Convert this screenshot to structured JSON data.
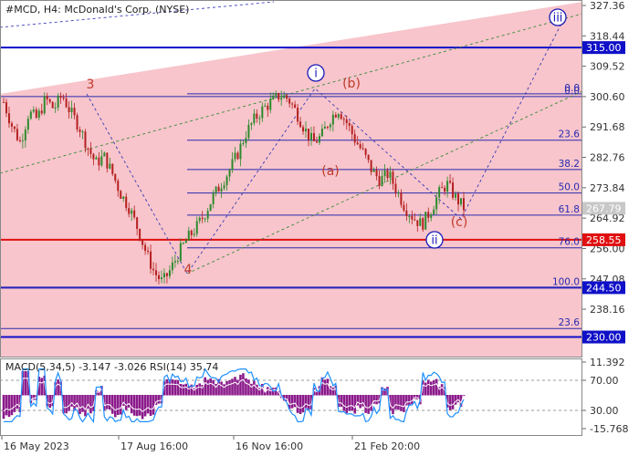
{
  "header": {
    "title": "#MCD, H4:  McDonald's Corp. (NYSE)",
    "indicator_title": "MACD(5,34,5) -3.147 -3.026 RSI(14) 35.74"
  },
  "colors": {
    "channel": "#f7c5cb",
    "level_blue": "#1010c8",
    "level_red": "#e01010",
    "fib_line": "#2a2ab0",
    "bull_candle": "#2d8a2d",
    "bear_candle": "#b52020",
    "price_badge": "#c8c8c8",
    "macd_hist": "#8b1a8b",
    "rsi_line": "#1e90ff",
    "macd_signal": "#ffffff",
    "wave_red": "#c0392b",
    "wave_blue": "#1a1ab8"
  },
  "chart_data": {
    "type": "candlestick",
    "instrument": "#MCD",
    "timeframe": "H4",
    "price_axis": {
      "min": 228.0,
      "max": 327.36,
      "ticks": [
        327.36,
        318.44,
        309.52,
        300.6,
        291.68,
        282.76,
        273.84,
        264.92,
        256.0,
        247.08,
        238.16,
        229.24
      ]
    },
    "x_tick_labels": [
      "16 May 2023",
      "17 Aug 16:00",
      "16 Nov 16:00",
      "21 Feb 20:00"
    ],
    "current_price": 267.79,
    "close_path": [
      299,
      292,
      287,
      296,
      294,
      300,
      297,
      301,
      296,
      292,
      286,
      281,
      283,
      278,
      272,
      268,
      262,
      255,
      249,
      246,
      250,
      255,
      259,
      262,
      266,
      271,
      275,
      279,
      284,
      290,
      294,
      297,
      299,
      301,
      300,
      296,
      291,
      287,
      289,
      294,
      297,
      293,
      288,
      284,
      279,
      276,
      278,
      273,
      268,
      265,
      263,
      267,
      272,
      275,
      271,
      268
    ],
    "levels": [
      {
        "price": 315.0,
        "label": "315.00",
        "color": "blue"
      },
      {
        "price": 258.55,
        "label": "258.55",
        "color": "red"
      },
      {
        "price": 244.5,
        "label": "244.50",
        "color": "blue"
      },
      {
        "price": 230.0,
        "label": "230.00",
        "color": "blue"
      }
    ],
    "fib_levels": [
      {
        "label": "0.0",
        "price": 301.4
      },
      {
        "label": "0.0",
        "price": 300.6
      },
      {
        "label": "23.6",
        "price": 287.8
      },
      {
        "label": "38.2",
        "price": 279.2
      },
      {
        "label": "50.0",
        "price": 272.3
      },
      {
        "label": "61.8",
        "price": 265.8
      },
      {
        "label": "76.0",
        "price": 256.2
      },
      {
        "label": "100.0",
        "price": 244.5
      },
      {
        "label": "23.6",
        "price": 232.5
      }
    ],
    "wave_labels": [
      {
        "text": "3",
        "style": "red"
      },
      {
        "text": "4",
        "style": "red"
      },
      {
        "text": "(a)",
        "style": "red"
      },
      {
        "text": "(b)",
        "style": "red"
      },
      {
        "text": "(c)",
        "style": "red"
      },
      {
        "text": "i",
        "style": "blue-circle"
      },
      {
        "text": "ii",
        "style": "blue-circle"
      },
      {
        "text": "iii",
        "style": "blue-circle"
      }
    ],
    "indicator": {
      "name": "MACD(5,34,5) + RSI(14)",
      "macd": -3.147,
      "signal": -3.026,
      "rsi": 35.74,
      "axis_ticks": [
        11.392,
        70.0,
        30.0,
        -15.768
      ],
      "rsi_levels": [
        70,
        30
      ]
    }
  }
}
